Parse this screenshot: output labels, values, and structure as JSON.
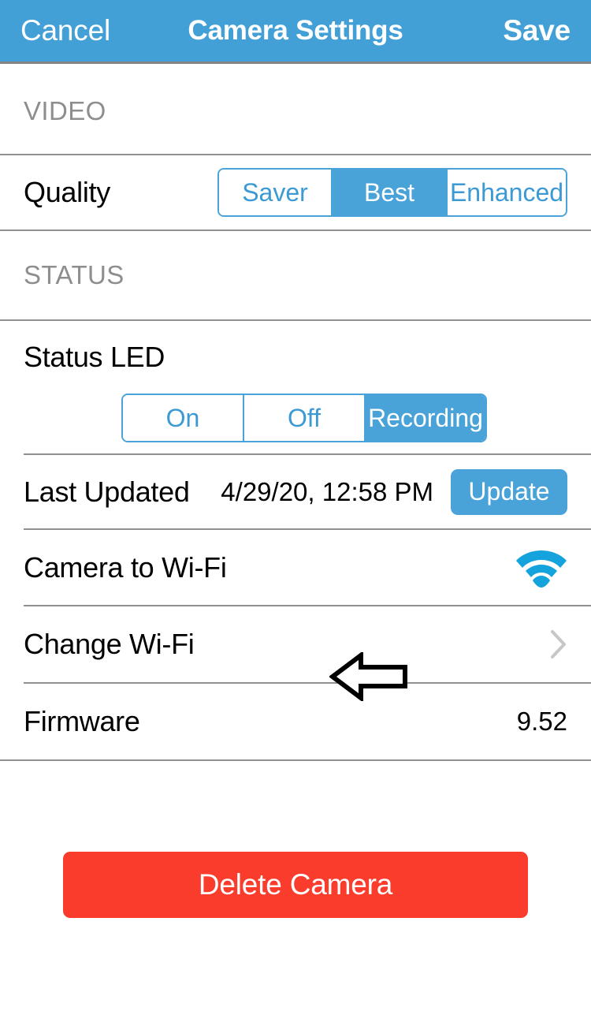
{
  "header": {
    "cancel_label": "Cancel",
    "title": "Camera Settings",
    "save_label": "Save",
    "background_color": "#42a0d6"
  },
  "sections": {
    "video": {
      "header": "VIDEO",
      "quality": {
        "label": "Quality",
        "options": [
          "Saver",
          "Best",
          "Enhanced"
        ],
        "selected": "Best"
      }
    },
    "status": {
      "header": "STATUS",
      "status_led": {
        "label": "Status LED",
        "options": [
          "On",
          "Off",
          "Recording"
        ],
        "selected": "Recording"
      },
      "last_updated": {
        "label": "Last Updated",
        "value": "4/29/20, 12:58 PM",
        "button_label": "Update"
      },
      "camera_to_wifi": {
        "label": "Camera to Wi-Fi",
        "icon": "wifi-icon"
      },
      "change_wifi": {
        "label": "Change Wi-Fi",
        "icon": "chevron-right-icon"
      },
      "firmware": {
        "label": "Firmware",
        "value": "9.52"
      }
    }
  },
  "footer": {
    "delete_label": "Delete Camera",
    "delete_color": "#fa3c2d"
  },
  "annotation": {
    "arrow": "arrow-left-annotation"
  },
  "colors": {
    "accent_blue": "#49a3d9",
    "nav_blue": "#42a0d6",
    "danger_red": "#fa3c2d",
    "section_gray": "#8e8e8e",
    "separator": "#6b6b6b"
  }
}
